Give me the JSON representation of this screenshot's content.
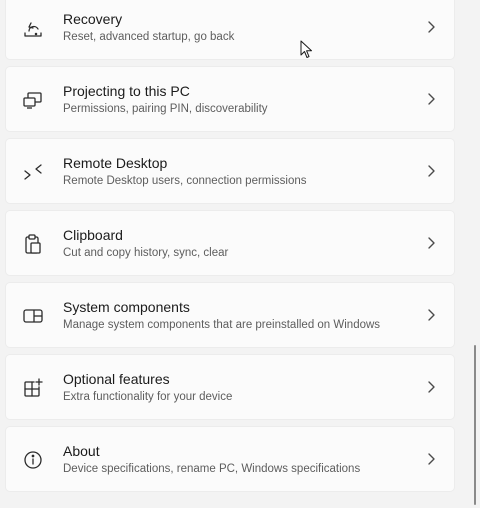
{
  "settings_items": [
    {
      "title": "Recovery",
      "subtitle": "Reset, advanced startup, go back",
      "icon": "recovery-icon"
    },
    {
      "title": "Projecting to this PC",
      "subtitle": "Permissions, pairing PIN, discoverability",
      "icon": "projecting-icon"
    },
    {
      "title": "Remote Desktop",
      "subtitle": "Remote Desktop users, connection permissions",
      "icon": "remote-desktop-icon"
    },
    {
      "title": "Clipboard",
      "subtitle": "Cut and copy history, sync, clear",
      "icon": "clipboard-icon"
    },
    {
      "title": "System components",
      "subtitle": "Manage system components that are preinstalled on Windows",
      "icon": "system-components-icon"
    },
    {
      "title": "Optional features",
      "subtitle": "Extra functionality for your device",
      "icon": "optional-features-icon"
    },
    {
      "title": "About",
      "subtitle": "Device specifications, rename PC, Windows specifications",
      "icon": "info-icon"
    }
  ]
}
